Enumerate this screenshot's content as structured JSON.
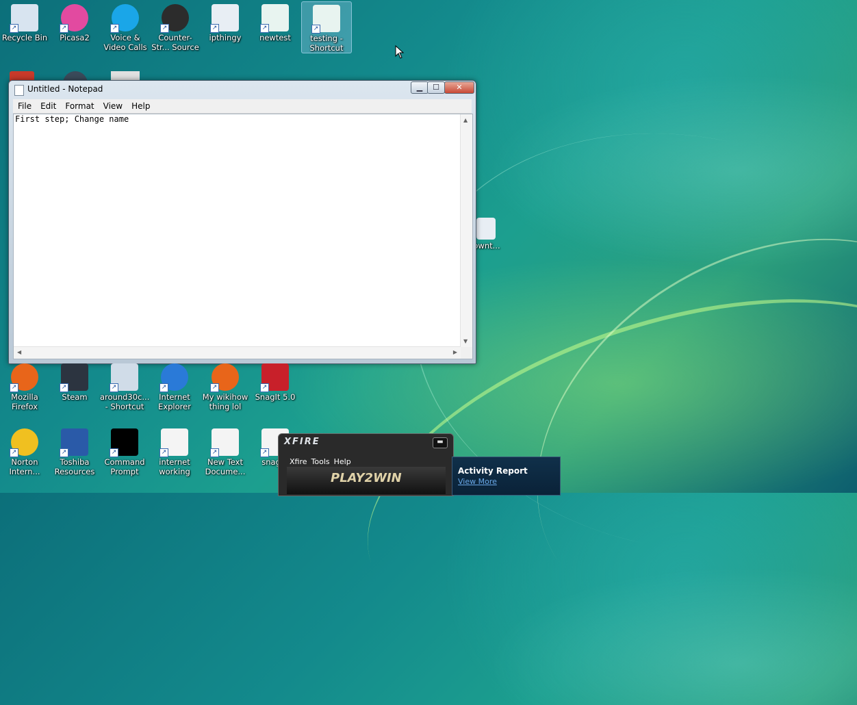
{
  "desktop": {
    "top_icons": [
      {
        "label": "Recycle Bin",
        "icon": "recycle-bin-icon",
        "color": "#d8e4f0"
      },
      {
        "label": "Picasa2",
        "icon": "picasa-icon",
        "color": "#e24aa0"
      },
      {
        "label": "Voice & Video Calls",
        "icon": "skype-icon",
        "color": "#1aa6e8"
      },
      {
        "label": "Counter-Str... Source",
        "icon": "counter-strike-icon",
        "color": "#2c2c2c"
      },
      {
        "label": "ipthingy",
        "icon": "settings-file-icon",
        "color": "#e8eef4"
      },
      {
        "label": "newtest",
        "icon": "script-icon",
        "color": "#e8f4f0"
      },
      {
        "label": "testing - Shortcut",
        "icon": "script-icon",
        "color": "#e8f4f0"
      }
    ],
    "bottom_icons_row1": [
      {
        "label": "Mozilla Firefox",
        "icon": "firefox-icon",
        "color": "#e8651a"
      },
      {
        "label": "Steam",
        "icon": "steam-icon",
        "color": "#2c3440"
      },
      {
        "label": "around30c... - Shortcut",
        "icon": "settings-file-icon",
        "color": "#d0dce8"
      },
      {
        "label": "Internet Explorer",
        "icon": "internet-explorer-icon",
        "color": "#2a7ad8"
      },
      {
        "label": "My wikihow thing lol",
        "icon": "firefox-icon",
        "color": "#e8651a"
      },
      {
        "label": "SnagIt 5.0",
        "icon": "snagit-icon",
        "color": "#c8202a"
      }
    ],
    "bottom_icons_row2": [
      {
        "label": "Norton Intern...",
        "icon": "norton-globe-icon",
        "color": "#f0c020"
      },
      {
        "label": "Toshiba Resources",
        "icon": "toshiba-icon",
        "color": "#2a5aa8"
      },
      {
        "label": "Command Prompt",
        "icon": "command-prompt-icon",
        "color": "#000000"
      },
      {
        "label": "internet working",
        "icon": "text-document-icon",
        "color": "#f4f4f4"
      },
      {
        "label": "New Text Docume...",
        "icon": "text-document-icon",
        "color": "#f4f4f4"
      },
      {
        "label": "snag-it",
        "icon": "text-document-icon",
        "color": "#f4f4f4"
      }
    ],
    "hidden_icon_label": "ownt..."
  },
  "notepad": {
    "title": "Untitled - Notepad",
    "menu": [
      "File",
      "Edit",
      "Format",
      "View",
      "Help"
    ],
    "content": "First step; Change name",
    "minimize": "▁",
    "maximize": "☐",
    "close": "✕"
  },
  "xfire": {
    "title": "XFIRE",
    "menu": [
      "Xfire",
      "Tools",
      "Help"
    ],
    "ad_text": "PLAY2WIN",
    "minimize": "▬"
  },
  "activity_report": {
    "title": "Activity Report",
    "link": "View More"
  }
}
